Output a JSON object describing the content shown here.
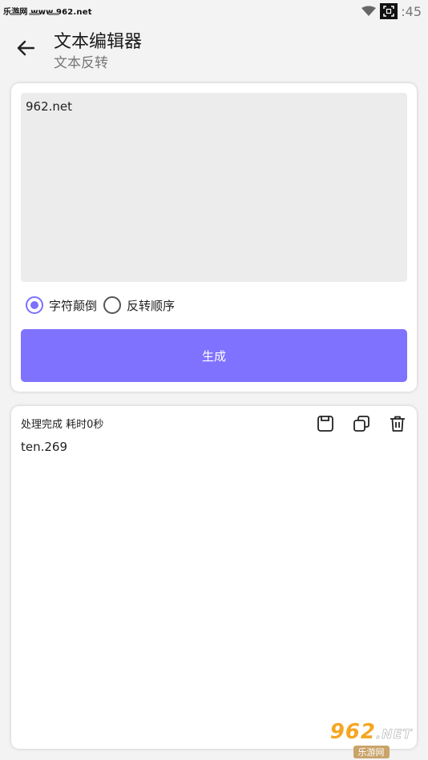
{
  "status_bar": {
    "watermark": "乐游网 www.962.net",
    "time": ":45"
  },
  "header": {
    "title": "文本编辑器",
    "subtitle": "文本反转"
  },
  "input": {
    "value": "962.net"
  },
  "options": [
    {
      "label": "字符颠倒",
      "checked": true
    },
    {
      "label": "反转顺序",
      "checked": false
    }
  ],
  "generate_label": "生成",
  "output": {
    "status": "处理完成 耗时0秒",
    "result": "ten.269"
  },
  "watermark_bottom": {
    "main": "962",
    "net": ".NET",
    "sub": "乐游网"
  },
  "colors": {
    "accent": "#7f72ff",
    "radio_accent": "#7c70ff",
    "input_bg": "#ececec",
    "page_bg": "#f3f3f3"
  }
}
